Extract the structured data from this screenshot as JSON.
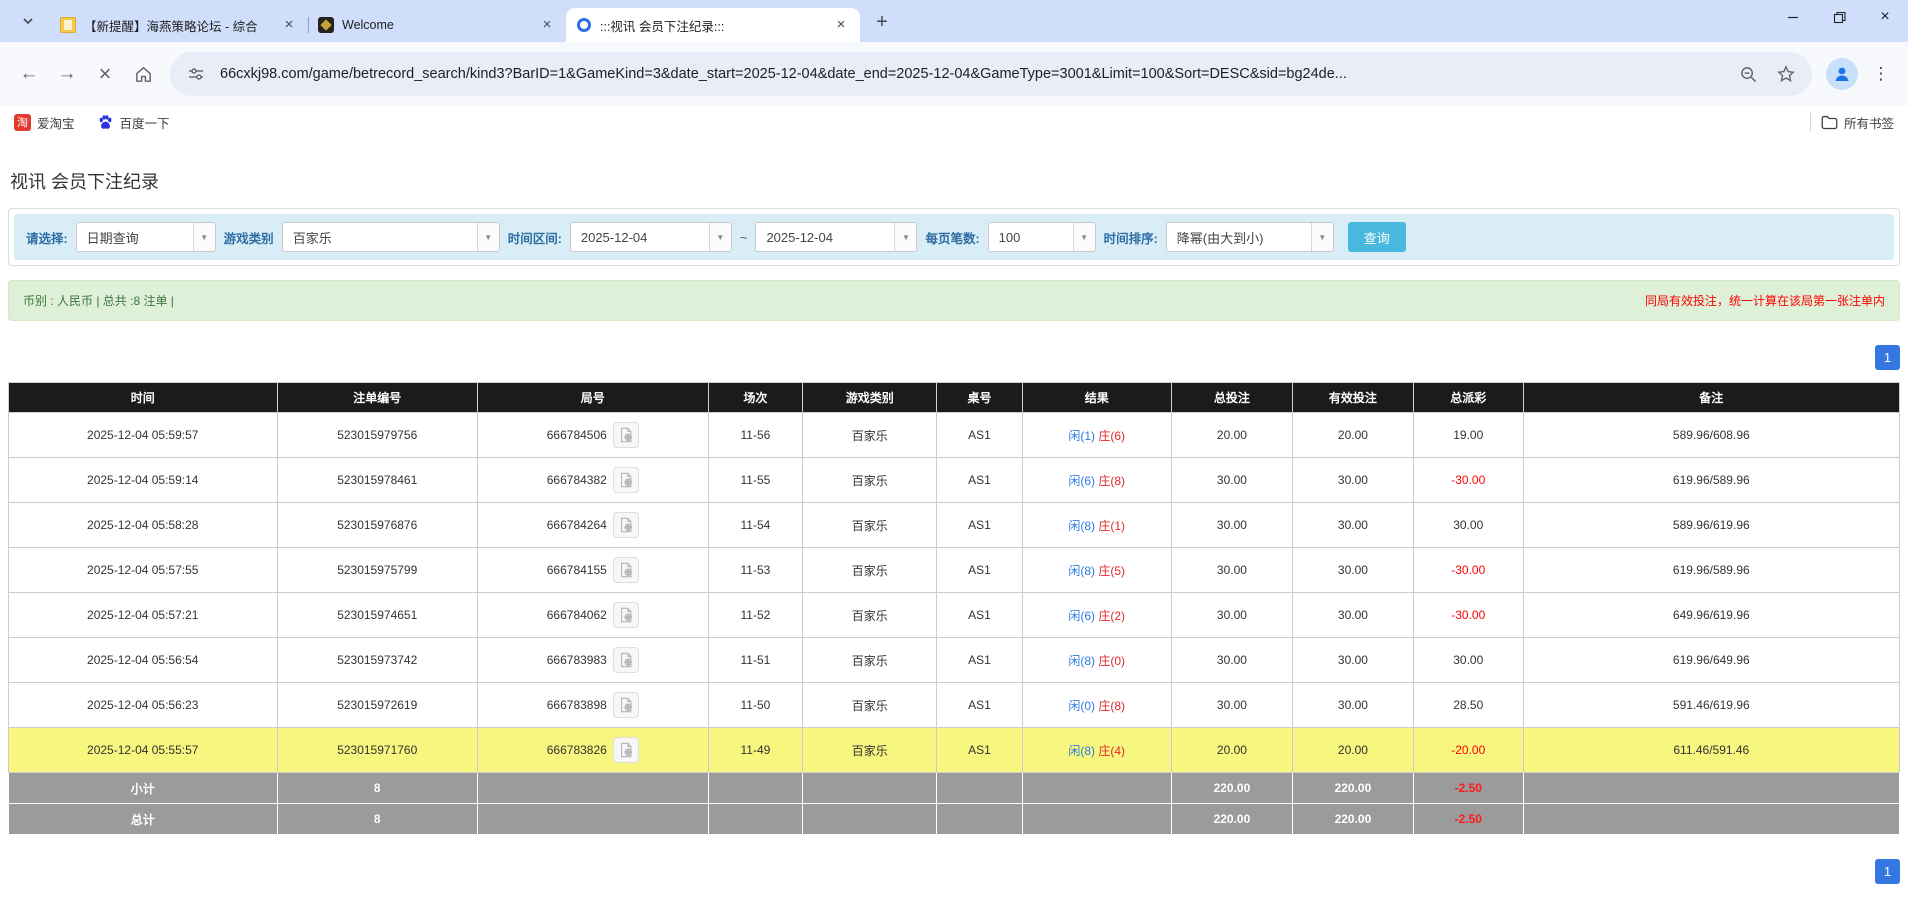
{
  "browser": {
    "tabs": [
      {
        "title": "【新提醒】海燕策略论坛 - 综合",
        "active": false
      },
      {
        "title": "Welcome",
        "active": false
      },
      {
        "title": ":::视讯 会员下注纪录:::",
        "active": true
      }
    ],
    "new_tab_label": "+",
    "url": "66cxkj98.com/game/betrecord_search/kind3?BarID=1&GameKind=3&date_start=2025-12-04&date_end=2025-12-04&GameType=3001&Limit=100&Sort=DESC&sid=bg24de...",
    "bookmarks": [
      {
        "label": "爱淘宝",
        "icon_glyph": "淘"
      },
      {
        "label": "百度一下"
      }
    ],
    "all_bookmarks_label": "所有书签"
  },
  "page": {
    "title": "视讯 会员下注纪录",
    "filters": {
      "select_label": "请选择:",
      "select_value": "日期查询",
      "game_label": "游戏类别",
      "game_value": "百家乐",
      "range_label": "时间区间:",
      "date_start": "2025-12-04",
      "tilde": "~",
      "date_end": "2025-12-04",
      "per_page_label": "每页笔数:",
      "per_page_value": "100",
      "sort_label": "时间排序:",
      "sort_value": "降幂(由大到小)",
      "search_button": "查询"
    },
    "info_bar": {
      "left": "币别 : 人民币 | 总共 :8 注单 |",
      "right": "同局有效投注，统一计算在该局第一张注单内"
    },
    "pagination": {
      "current": "1"
    },
    "table": {
      "headers": [
        "时间",
        "注单编号",
        "局号",
        "场次",
        "游戏类别",
        "桌号",
        "结果",
        "总投注",
        "有效投注",
        "总派彩",
        "备注"
      ],
      "rows": [
        {
          "time": "2025-12-04 05:59:57",
          "bet_id": "523015979756",
          "round_id": "666784506",
          "session": "11-56",
          "game": "百家乐",
          "table_no": "AS1",
          "result_player": "闲(1)",
          "result_banker": "庄(6)",
          "total_bet": "20.00",
          "valid_bet": "20.00",
          "payout": "19.00",
          "note": "589.96/608.96",
          "highlight": false
        },
        {
          "time": "2025-12-04 05:59:14",
          "bet_id": "523015978461",
          "round_id": "666784382",
          "session": "11-55",
          "game": "百家乐",
          "table_no": "AS1",
          "result_player": "闲(6)",
          "result_banker": "庄(8)",
          "total_bet": "30.00",
          "valid_bet": "30.00",
          "payout": "-30.00",
          "note": "619.96/589.96",
          "highlight": false
        },
        {
          "time": "2025-12-04 05:58:28",
          "bet_id": "523015976876",
          "round_id": "666784264",
          "session": "11-54",
          "game": "百家乐",
          "table_no": "AS1",
          "result_player": "闲(8)",
          "result_banker": "庄(1)",
          "total_bet": "30.00",
          "valid_bet": "30.00",
          "payout": "30.00",
          "note": "589.96/619.96",
          "highlight": false
        },
        {
          "time": "2025-12-04 05:57:55",
          "bet_id": "523015975799",
          "round_id": "666784155",
          "session": "11-53",
          "game": "百家乐",
          "table_no": "AS1",
          "result_player": "闲(8)",
          "result_banker": "庄(5)",
          "total_bet": "30.00",
          "valid_bet": "30.00",
          "payout": "-30.00",
          "note": "619.96/589.96",
          "highlight": false
        },
        {
          "time": "2025-12-04 05:57:21",
          "bet_id": "523015974651",
          "round_id": "666784062",
          "session": "11-52",
          "game": "百家乐",
          "table_no": "AS1",
          "result_player": "闲(6)",
          "result_banker": "庄(2)",
          "total_bet": "30.00",
          "valid_bet": "30.00",
          "payout": "-30.00",
          "note": "649.96/619.96",
          "highlight": false
        },
        {
          "time": "2025-12-04 05:56:54",
          "bet_id": "523015973742",
          "round_id": "666783983",
          "session": "11-51",
          "game": "百家乐",
          "table_no": "AS1",
          "result_player": "闲(8)",
          "result_banker": "庄(0)",
          "total_bet": "30.00",
          "valid_bet": "30.00",
          "payout": "30.00",
          "note": "619.96/649.96",
          "highlight": false
        },
        {
          "time": "2025-12-04 05:56:23",
          "bet_id": "523015972619",
          "round_id": "666783898",
          "session": "11-50",
          "game": "百家乐",
          "table_no": "AS1",
          "result_player": "闲(0)",
          "result_banker": "庄(8)",
          "total_bet": "30.00",
          "valid_bet": "30.00",
          "payout": "28.50",
          "note": "591.46/619.96",
          "highlight": false
        },
        {
          "time": "2025-12-04 05:55:57",
          "bet_id": "523015971760",
          "round_id": "666783826",
          "session": "11-49",
          "game": "百家乐",
          "table_no": "AS1",
          "result_player": "闲(8)",
          "result_banker": "庄(4)",
          "total_bet": "20.00",
          "valid_bet": "20.00",
          "payout": "-20.00",
          "note": "611.46/591.46",
          "highlight": true
        }
      ],
      "subtotal": {
        "label": "小计",
        "count": "8",
        "total_bet": "220.00",
        "valid_bet": "220.00",
        "payout": "-2.50"
      },
      "total": {
        "label": "总计",
        "count": "8",
        "total_bet": "220.00",
        "valid_bet": "220.00",
        "payout": "-2.50"
      }
    }
  },
  "colors": {
    "accent_blue": "#2a7bde",
    "negative_red": "#ff0000",
    "header_black": "#1b1b1b",
    "highlight_yellow": "#f7f67e",
    "footer_gray": "#9b9b9b",
    "info_green_bg": "#dff0d8",
    "filter_blue_bg": "#d9edf7",
    "search_btn": "#49b8de",
    "tabstrip_bg": "#cfdefb"
  }
}
